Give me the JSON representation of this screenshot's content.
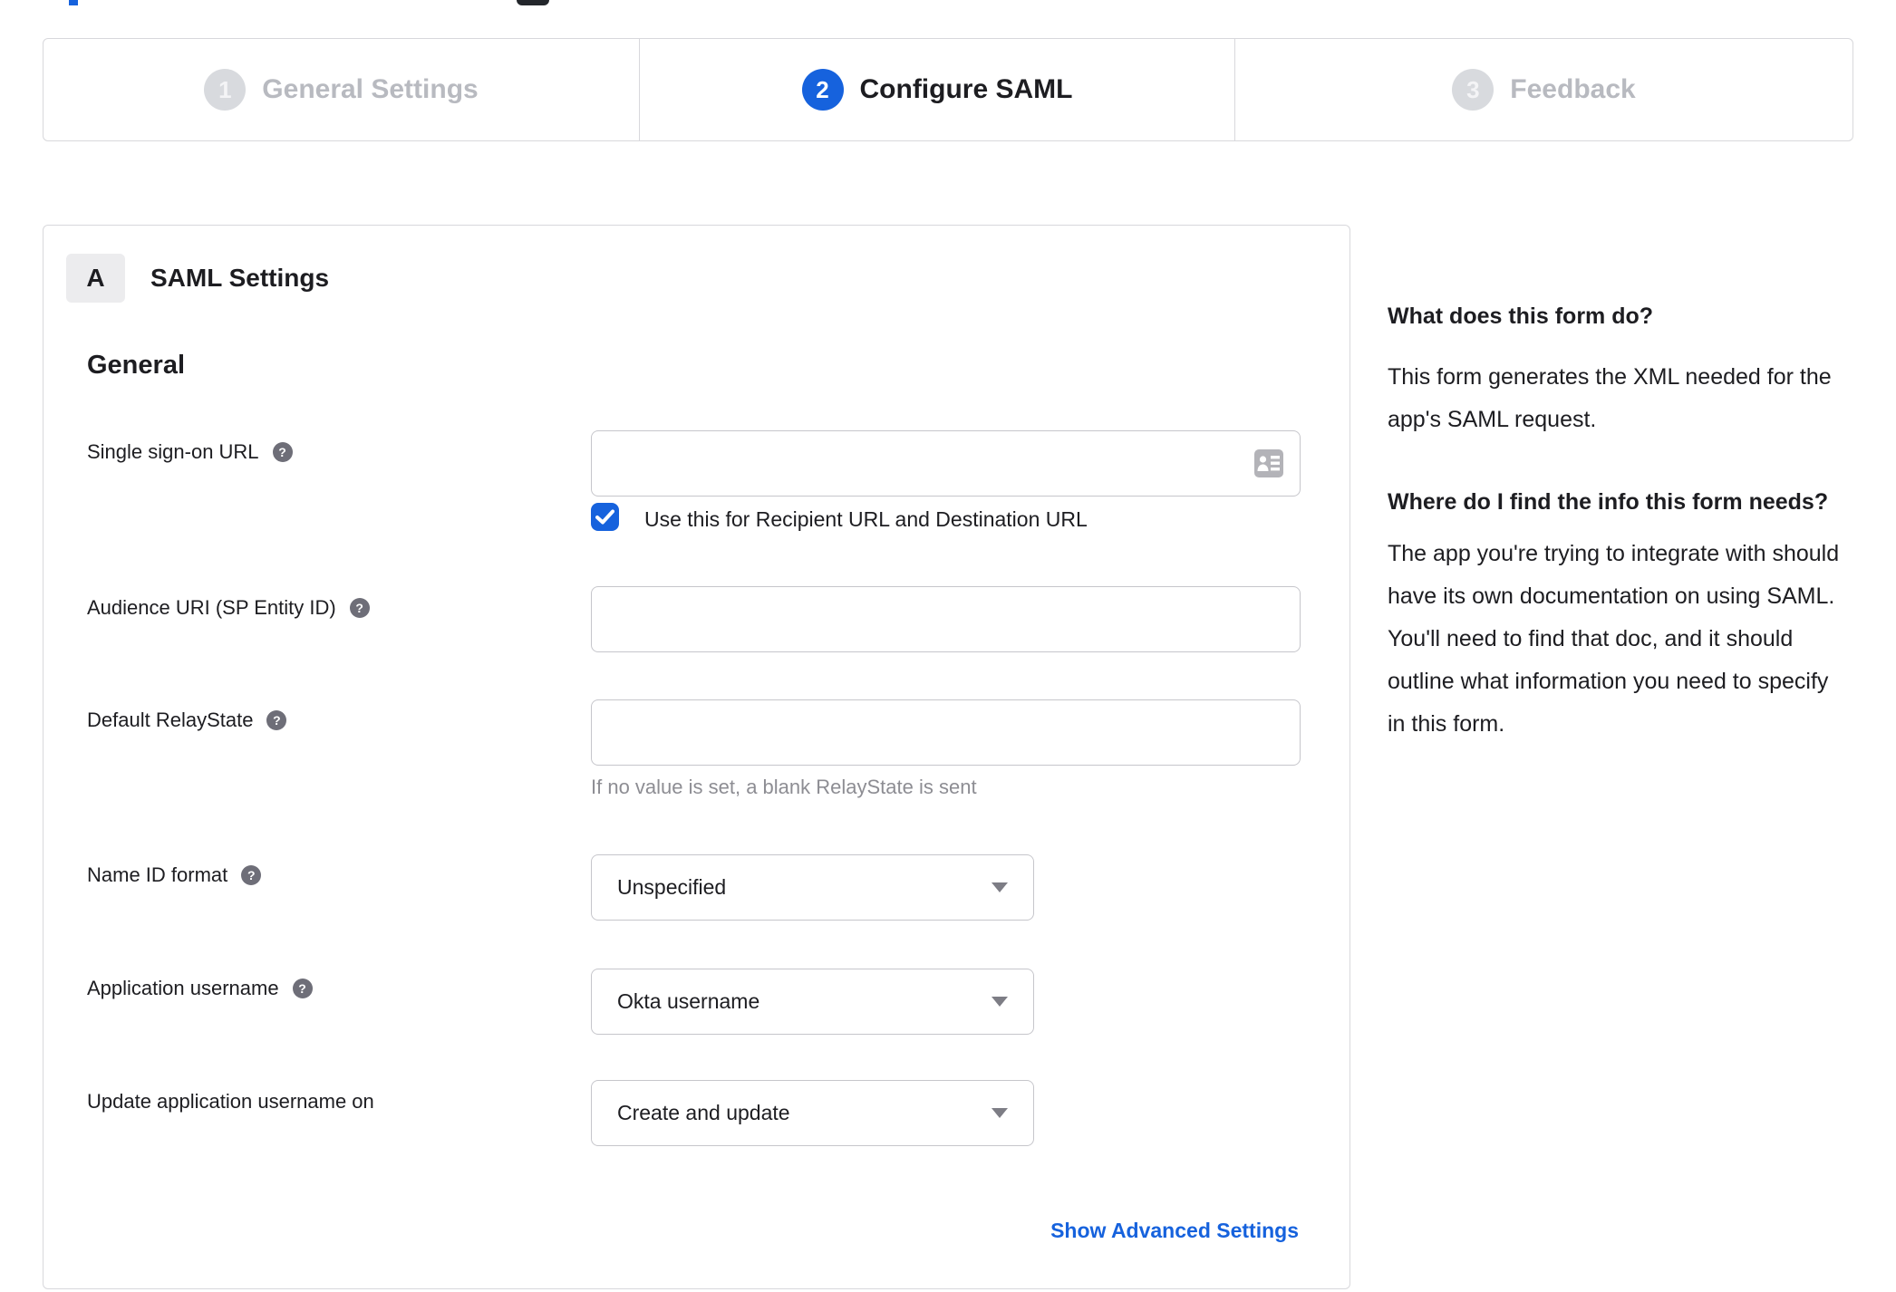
{
  "colors": {
    "accent_blue": "#1662dd",
    "inactive_gray": "#b8bac0",
    "panel_border": "#d8d8dc",
    "input_border": "#c6c6cb",
    "help_icon_bg": "#6e6e78",
    "hint_text": "#8d8d93"
  },
  "stepper": {
    "steps": [
      {
        "number": "1",
        "label": "General Settings",
        "active": false
      },
      {
        "number": "2",
        "label": "Configure SAML",
        "active": true
      },
      {
        "number": "3",
        "label": "Feedback",
        "active": false
      }
    ]
  },
  "panel": {
    "badge": "A",
    "title": "SAML Settings",
    "section": "General",
    "sso": {
      "label": "Single sign-on URL",
      "value": "",
      "checkbox_label": "Use this for Recipient URL and Destination URL",
      "checkbox_checked": true
    },
    "audience": {
      "label": "Audience URI (SP Entity ID)",
      "value": ""
    },
    "relay": {
      "label": "Default RelayState",
      "value": "",
      "hint": "If no value is set, a blank RelayState is sent"
    },
    "name_id": {
      "label": "Name ID format",
      "value": "Unspecified"
    },
    "app_username": {
      "label": "Application username",
      "value": "Okta username"
    },
    "update_username": {
      "label": "Update application username on",
      "value": "Create and update"
    },
    "advanced_link": "Show Advanced Settings"
  },
  "help_panel": {
    "section1": {
      "heading": "What does this form do?",
      "body": "This form generates the XML needed for the app's SAML request."
    },
    "section2": {
      "heading": "Where do I find the info this form needs?",
      "body": "The app you're trying to integrate with should have its own documentation on using SAML. You'll need to find that doc, and it should outline what information you need to specify in this form."
    }
  },
  "icons": {
    "help_glyph": "?"
  }
}
